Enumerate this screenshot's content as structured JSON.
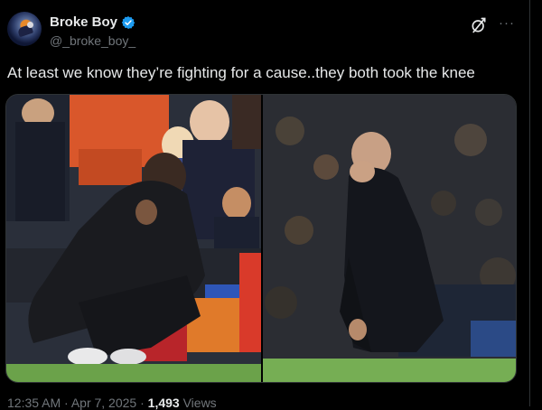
{
  "post": {
    "author_name": "Broke Boy",
    "handle": "@_broke_boy_",
    "text": "At least we know they’re fighting for a cause..they both took the knee",
    "time": "12:35 AM · Apr 7, 2025 · ",
    "views_count": "1,493",
    "views_label": " Views",
    "more_glyph": "···"
  },
  "media": {
    "left_image_desc": "Man in black puffer coat crouching on touchline with hand over face",
    "right_image_desc": "Bald man in black coat crouching with hand over face"
  },
  "colors": {
    "background": "#000000",
    "text": "#e7e9ea",
    "secondary": "#71767b",
    "verified": "#1d9bf0"
  },
  "icons": [
    "verified-badge-icon",
    "grok-icon",
    "more-icon"
  ]
}
